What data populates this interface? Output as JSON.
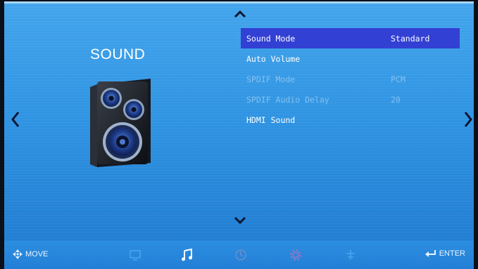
{
  "page": {
    "title": "SOUND"
  },
  "icon": "speaker-icon",
  "nav": {
    "up": "^",
    "down": "v",
    "left": "‹",
    "right": "›"
  },
  "menu": [
    {
      "label": "Sound Mode",
      "value": "Standard",
      "state": "selected"
    },
    {
      "label": "Auto Volume",
      "value": "",
      "state": "normal"
    },
    {
      "label": "SPDIF Mode",
      "value": "PCM",
      "state": "disabled"
    },
    {
      "label": "SPDIF Audio Delay",
      "value": "20",
      "state": "disabled"
    },
    {
      "label": "HDMI Sound",
      "value": "",
      "state": "normal"
    }
  ],
  "bottom": {
    "move_label": "MOVE",
    "enter_label": "ENTER",
    "tabs": [
      {
        "name": "picture-tab-icon",
        "active": false
      },
      {
        "name": "music-note-tab-icon",
        "active": true
      },
      {
        "name": "clock-tab-icon",
        "active": false
      },
      {
        "name": "gear-tab-icon",
        "active": false
      },
      {
        "name": "lock-tab-icon",
        "active": false
      }
    ]
  },
  "colors": {
    "background": "#2f93e2",
    "highlight": "#3340d4",
    "arrow": "#0b1730"
  }
}
